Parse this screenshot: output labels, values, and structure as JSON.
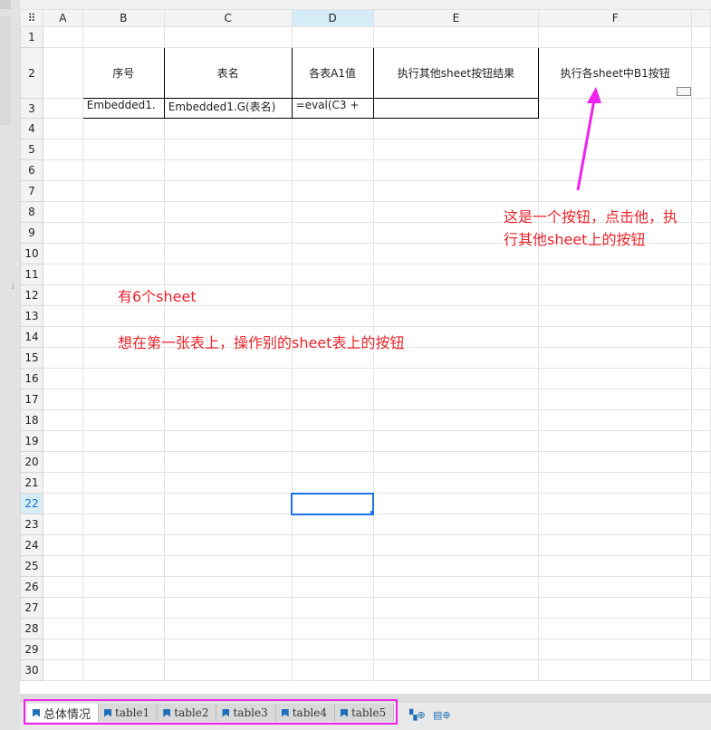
{
  "columns": [
    "A",
    "B",
    "C",
    "D",
    "E",
    "F"
  ],
  "selected_column": "D",
  "selected_row": 22,
  "row_count": 30,
  "cells": {
    "B2": "序号",
    "C2": "表名",
    "D2": "各表A1值",
    "E2": "执行其他sheet按钮结果",
    "F2": "执行各sheet中B1按钮",
    "B3": "Embedded1.",
    "C3": "Embedded1.G(表名)",
    "D3": "=eval(C3 +"
  },
  "annotations": {
    "button_note_line1": "这是一个按钮，点击他，执",
    "button_note_line2": "行其他sheet上的按钮",
    "sheet_count_note": "有6个sheet",
    "goal_note": "想在第一张表上，操作别的sheet表上的按钮"
  },
  "tabs": [
    "总体情况",
    "table1",
    "table2",
    "table3",
    "table4",
    "table5"
  ],
  "active_tab": "总体情况",
  "colors": {
    "annotation_red": "#e8242b",
    "arrow_magenta": "#ee22ee",
    "selection_blue": "#1a73e8"
  },
  "icons": {
    "sheet_tab": "sheet-icon",
    "add_sheet": "add-sheet-icon",
    "add_report": "add-report-icon"
  }
}
